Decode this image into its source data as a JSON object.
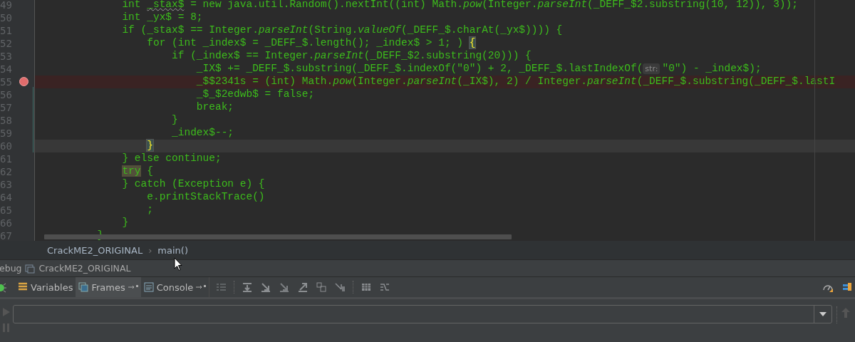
{
  "editor": {
    "lines": [
      {
        "number": "49",
        "breakpoint": false,
        "current": false,
        "parts": [
          {
            "kind": "code",
            "text": "            int "
          },
          {
            "kind": "warn",
            "text": "_stax$"
          },
          {
            "kind": "code",
            "text": " = new java.util.Random().nextInt((int) Math.*pow*(Integer.*parseInt*(_DEFF_$2.substring(10, 12)), 3));"
          }
        ]
      },
      {
        "number": "50",
        "breakpoint": false,
        "current": false,
        "parts": [
          {
            "kind": "code",
            "text": "            int _yx$ = 8;"
          }
        ]
      },
      {
        "number": "51",
        "breakpoint": false,
        "current": false,
        "parts": [
          {
            "kind": "code",
            "text": "            if (_stax$ == Integer.*parseInt*(String.*valueOf*(_DEFF_$.charAt(_yx$)))) {"
          }
        ]
      },
      {
        "number": "52",
        "breakpoint": false,
        "current": false,
        "parts": [
          {
            "kind": "code",
            "text": "                for (int _index$ = _DEFF_$.length(); _index$ > 1; ) "
          },
          {
            "kind": "match",
            "text": "{"
          }
        ]
      },
      {
        "number": "53",
        "breakpoint": false,
        "current": false,
        "parts": [
          {
            "kind": "code",
            "text": "                    if (_index$ == Integer.*parseInt*(_DEFF_$2.substring(20))) {"
          }
        ]
      },
      {
        "number": "54",
        "breakpoint": false,
        "current": false,
        "parts": [
          {
            "kind": "code",
            "text": "                        _IX$ += _DEFF_$.substring(_DEFF_$.indexOf(\"0\") + 2, _DEFF_$.lastIndexOf("
          },
          {
            "kind": "hint",
            "text": "str:"
          },
          {
            "kind": "code",
            "text": "\"0\") - _index$);"
          }
        ]
      },
      {
        "number": "55",
        "breakpoint": true,
        "current": false,
        "parts": [
          {
            "kind": "code",
            "text": "                        _$$2341s = (int) Math.*pow*(Integer.*parseInt*(_IX$), 2) / Integer.*parseInt*(_DEFF_$.substring(_DEFF_$.lastI"
          }
        ]
      },
      {
        "number": "56",
        "breakpoint": false,
        "current": false,
        "parts": [
          {
            "kind": "code",
            "text": "                        _$_$2edwb$ = false;"
          }
        ]
      },
      {
        "number": "57",
        "breakpoint": false,
        "current": false,
        "parts": [
          {
            "kind": "code",
            "text": "                        break;"
          }
        ]
      },
      {
        "number": "58",
        "breakpoint": false,
        "current": false,
        "parts": [
          {
            "kind": "code",
            "text": "                    }"
          }
        ]
      },
      {
        "number": "59",
        "breakpoint": false,
        "current": false,
        "parts": [
          {
            "kind": "code",
            "text": "                    _index$--;"
          }
        ]
      },
      {
        "number": "60",
        "breakpoint": false,
        "current": true,
        "parts": [
          {
            "kind": "match",
            "text": "                }"
          }
        ]
      },
      {
        "number": "61",
        "breakpoint": false,
        "current": false,
        "parts": [
          {
            "kind": "code",
            "text": "            } else continue;"
          }
        ]
      },
      {
        "number": "62",
        "breakpoint": false,
        "current": false,
        "parts": [
          {
            "kind": "usage",
            "text": "            try"
          },
          {
            "kind": "code",
            "text": " {"
          }
        ]
      },
      {
        "number": "63",
        "breakpoint": false,
        "current": false,
        "parts": [
          {
            "kind": "code",
            "text": "            } catch (Exception e) {"
          }
        ]
      },
      {
        "number": "64",
        "breakpoint": false,
        "current": false,
        "parts": [
          {
            "kind": "code",
            "text": "                e.printStackTrace()"
          }
        ]
      },
      {
        "number": "65",
        "breakpoint": false,
        "current": false,
        "parts": [
          {
            "kind": "code",
            "text": "                ;"
          }
        ]
      },
      {
        "number": "66",
        "breakpoint": false,
        "current": false,
        "parts": [
          {
            "kind": "code",
            "text": "            }"
          }
        ]
      },
      {
        "number": "67",
        "breakpoint": false,
        "current": false,
        "parts": [
          {
            "kind": "code",
            "text": "        }"
          }
        ]
      }
    ]
  },
  "breadcrumbs": [
    "CrackME2_ORIGINAL",
    "main()"
  ],
  "breadcrumb_separator": "›",
  "debug_bar": {
    "title": "ebug",
    "config": "CrackME2_ORIGINAL"
  },
  "tabs": [
    {
      "label": "Variables",
      "selected": false,
      "pin": false
    },
    {
      "label": "Frames",
      "selected": true,
      "pin": true
    },
    {
      "label": "Console",
      "selected": false,
      "pin": true
    }
  ]
}
